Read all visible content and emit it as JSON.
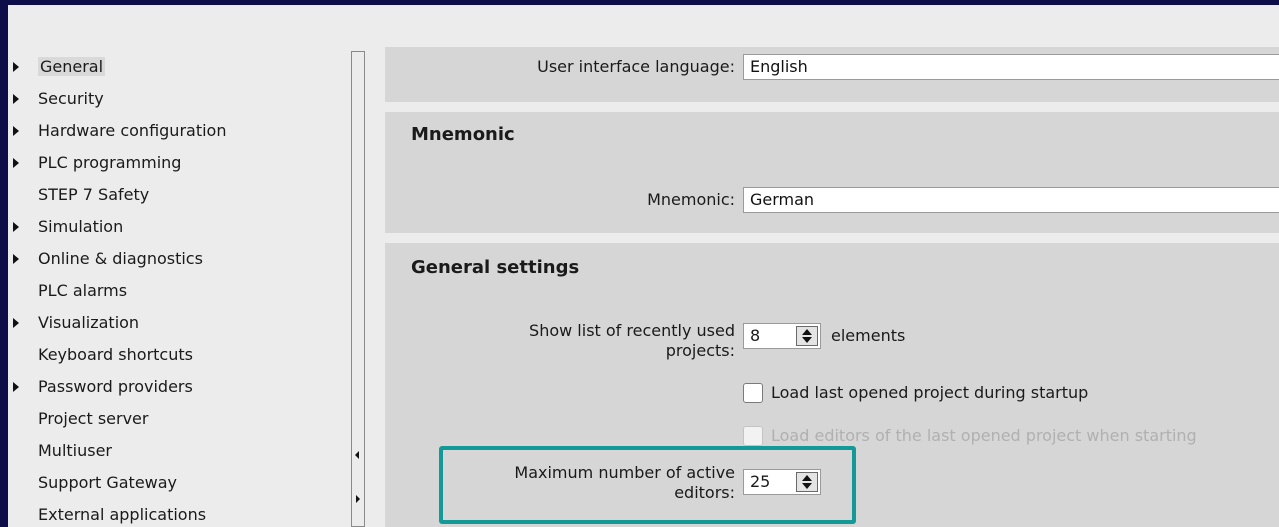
{
  "sidebar": {
    "items": [
      {
        "label": "General",
        "expandable": true,
        "selected": true
      },
      {
        "label": "Security",
        "expandable": true
      },
      {
        "label": "Hardware configuration",
        "expandable": true
      },
      {
        "label": "PLC programming",
        "expandable": true
      },
      {
        "label": "STEP 7 Safety",
        "expandable": false
      },
      {
        "label": "Simulation",
        "expandable": true
      },
      {
        "label": "Online & diagnostics",
        "expandable": true
      },
      {
        "label": "PLC alarms",
        "expandable": false
      },
      {
        "label": "Visualization",
        "expandable": true
      },
      {
        "label": "Keyboard shortcuts",
        "expandable": false
      },
      {
        "label": "Password providers",
        "expandable": true
      },
      {
        "label": "Project server",
        "expandable": false
      },
      {
        "label": "Multiuser",
        "expandable": false
      },
      {
        "label": "Support Gateway",
        "expandable": false
      },
      {
        "label": "External applications",
        "expandable": false
      }
    ]
  },
  "language": {
    "label": "User interface language:",
    "value": "English"
  },
  "mnemonic": {
    "title": "Mnemonic",
    "label": "Mnemonic:",
    "value": "German"
  },
  "general_settings": {
    "title": "General settings",
    "recent_label_line1": "Show list of recently used",
    "recent_label_line2": "projects:",
    "recent_value": "8",
    "recent_unit": "elements",
    "load_last_label": "Load last opened project during startup",
    "load_last_checked": false,
    "load_editors_label": "Load editors of the last opened project when starting",
    "load_editors_enabled": false,
    "max_editors_label_line1": "Maximum number of active",
    "max_editors_label_line2": "editors:",
    "max_editors_value": "25"
  },
  "colors": {
    "highlight": "#139a96",
    "panel": "#d6d6d6",
    "background": "#ececec",
    "outer_border": "#0d0d4a"
  }
}
